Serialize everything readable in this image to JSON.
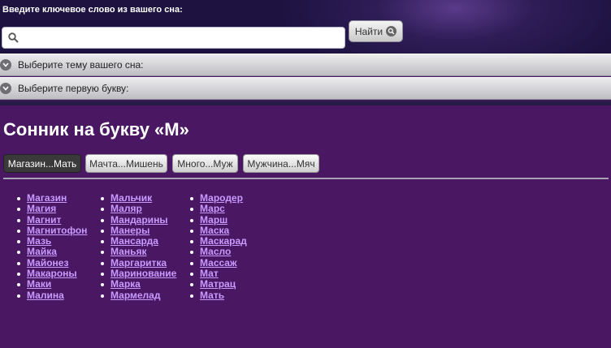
{
  "search": {
    "label": "Введите ключевое слово из вашего сна:",
    "value": "",
    "button_label": "Найти"
  },
  "accordion": {
    "theme_label": "Выберите тему вашего сна:",
    "letter_label": "Выберите первую букву:"
  },
  "page_title": "Сонник на букву «М»",
  "tabs": [
    {
      "label": "Магазин...Мать",
      "active": true
    },
    {
      "label": "Мачта...Мишень",
      "active": false
    },
    {
      "label": "Много...Муж",
      "active": false
    },
    {
      "label": "Мужчина...Мяч",
      "active": false
    }
  ],
  "words": {
    "col1": [
      "Магазин",
      "Магия",
      "Магнит",
      "Магнитофон",
      "Мазь",
      "Майка",
      "Майонез",
      "Макароны",
      "Маки",
      "Малина"
    ],
    "col2": [
      "Мальчик",
      "Маляр",
      "Мандарины",
      "Манеры",
      "Мансарда",
      "Маньяк",
      "Маргаритка",
      "Маринование",
      "Марка",
      "Мармелад"
    ],
    "col3": [
      "Мародер",
      "Марс",
      "Марш",
      "Маска",
      "Маскарад",
      "Масло",
      "Массаж",
      "Мат",
      "Матрац",
      "Мать"
    ]
  },
  "colors": {
    "background": "#4a1763",
    "link": "#c89bff",
    "header": "#1d1240"
  }
}
